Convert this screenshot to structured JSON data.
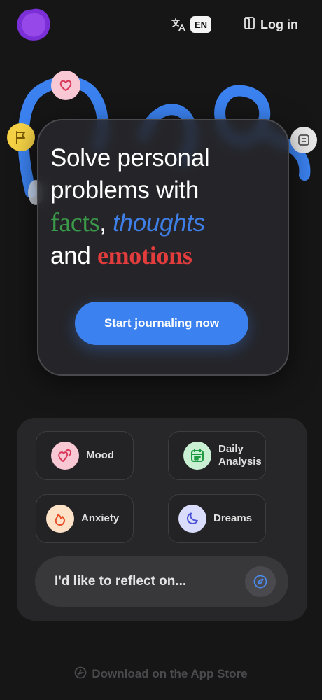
{
  "header": {
    "logo_icon": "purple-blob-logo",
    "translate_icon": "translate-icon",
    "language_code": "EN",
    "login_icon": "door-icon",
    "login_label": "Log in"
  },
  "hero": {
    "title_line1": "Solve personal",
    "title_line2": "problems with",
    "word_facts": "facts",
    "comma": ",",
    "word_thoughts": "thoughts",
    "word_and": "and",
    "word_emotions": "emotions",
    "cta_label": "Start journaling now",
    "colors": {
      "facts": "#3a9a4a",
      "thoughts": "#3f7fe8",
      "emotions": "#e23c3c",
      "cta": "#3b82f0"
    }
  },
  "topics": [
    {
      "label": "Mood",
      "icon": "hearts-icon",
      "icon_bg": "#f8c8d4"
    },
    {
      "label": "Daily Analysis",
      "icon": "calendar-icon",
      "icon_bg": "#c9f0d3"
    },
    {
      "label": "Anxiety",
      "icon": "flame-icon",
      "icon_bg": "#fde2c8"
    },
    {
      "label": "Dreams",
      "icon": "moon-icon",
      "icon_bg": "#d9dcfb"
    }
  ],
  "reflect": {
    "placeholder": "I'd like to reflect on...",
    "button_icon": "compass-icon"
  },
  "footer": {
    "appstore_icon": "app-store-icon",
    "appstore_label": "Download on the App Store"
  }
}
